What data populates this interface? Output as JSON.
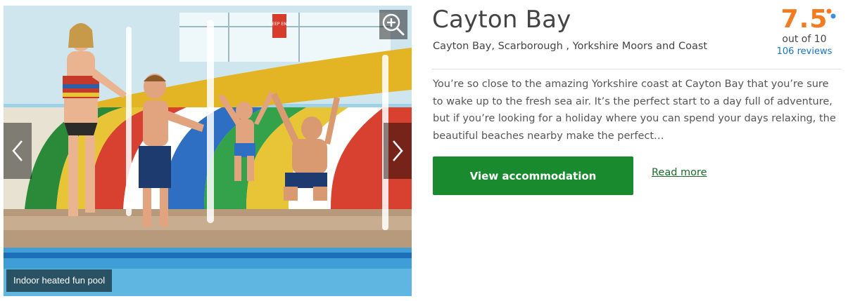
{
  "gallery": {
    "caption": "Indoor heated fun pool",
    "sign_text": "DEEP END",
    "icons": {
      "zoom": "zoom-in-icon",
      "prev": "chevron-left-icon",
      "next": "chevron-right-icon"
    }
  },
  "listing": {
    "title": "Cayton Bay",
    "location": "Cayton Bay, Scarborough , Yorkshire Moors and Coast",
    "description": "You’re so close to the amazing Yorkshire coast at Cayton Bay that you’re sure to wake up to the fresh sea air. It’s the perfect start to a day full of adventure, but if you’re looking for a holiday where you can spend your days relaxing, the beautiful beaches nearby make the perfect…"
  },
  "rating": {
    "score": "7.5",
    "out_of": "out of 10",
    "reviews": "106 reviews",
    "score_color": "#f47b20",
    "dot_colors": [
      "#f47b20",
      "#3d8fd9"
    ]
  },
  "actions": {
    "primary_label": "View accommodation",
    "secondary_label": "Read more",
    "primary_color": "#1a8a2f"
  }
}
